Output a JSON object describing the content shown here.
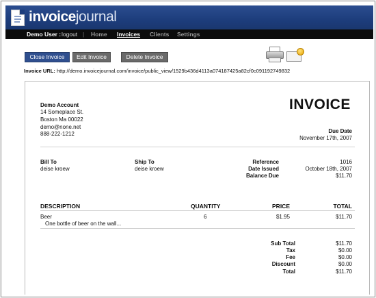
{
  "app": {
    "logo_bold": "invoice",
    "logo_light": "journal"
  },
  "nav": {
    "user": "Demo User :",
    "logout": "logout",
    "sep": "|",
    "tabs": [
      "Home",
      "Invoices",
      "Clients",
      "Settings"
    ],
    "active_tab": "Invoices"
  },
  "toolbar": {
    "close": "Close Invoice",
    "edit": "Edit Invoice",
    "delete": "Delete Invoice"
  },
  "invoice_url": {
    "label": "Invoice URL:",
    "value": "http://demo.invoicejournal.com/invoice/public_view/1529b436d4113a074187425a82cf0c091192749832"
  },
  "invoice": {
    "heading": "INVOICE",
    "from": {
      "name": "Demo Account",
      "address1": "14 Someplace St.",
      "address2": "Boston Ma 00022",
      "email": "demo@none.net",
      "phone": "888-222-1212"
    },
    "due_date_label": "Due Date",
    "due_date": "November 17th, 2007",
    "bill_to_label": "Bill To",
    "bill_to": "deise kroew",
    "ship_to_label": "Ship To",
    "ship_to": "deise kroew",
    "reference_label": "Reference",
    "reference": "1016",
    "date_issued_label": "Date Issued",
    "date_issued": "October 18th, 2007",
    "balance_due_label": "Balance Due",
    "balance_due": "$11.70",
    "columns": {
      "description": "DESCRIPTION",
      "quantity": "QUANTITY",
      "price": "PRICE",
      "total": "TOTAL"
    },
    "items": [
      {
        "description": "Beer",
        "note": "One bottle of beer on the wall...",
        "quantity": "6",
        "price": "$1.95",
        "total": "$11.70"
      }
    ],
    "totals": {
      "subtotal_label": "Sub Total",
      "subtotal": "$11.70",
      "tax_label": "Tax",
      "tax": "$0.00",
      "fee_label": "Fee",
      "fee": "$0.00",
      "discount_label": "Discount",
      "discount": "$0.00",
      "total_label": "Total",
      "total": "$11.70"
    }
  },
  "colors": {
    "header": "#1d3d7c",
    "nav": "#0c0c0c",
    "primary_button": "#2f4f8f",
    "secondary_button": "#6a6a6a"
  },
  "icons": [
    "document-icon",
    "printer-icon",
    "email-icon"
  ]
}
